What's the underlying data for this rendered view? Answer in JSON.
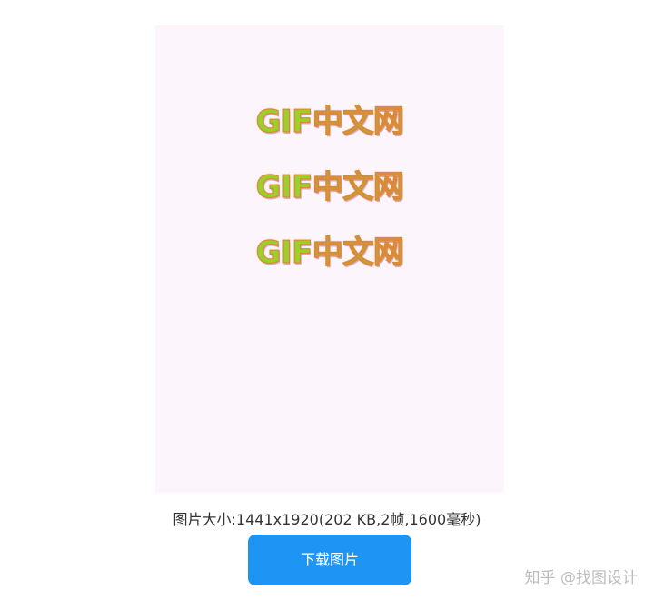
{
  "preview": {
    "lines": [
      "GIF中文网",
      "GIF中文网",
      "GIF中文网"
    ]
  },
  "image_info": "图片大小:1441x1920(202 KB,2帧,1600毫秒)",
  "download_button_label": "下载图片",
  "watermark": "知乎 @找图设计",
  "colors": {
    "canvas_background": "#fcf5fb",
    "button_background": "#1e95f5",
    "button_text": "#ffffff",
    "gif_text_fill": "#9bcf2a",
    "gif_text_outline": "#d98a3a"
  }
}
